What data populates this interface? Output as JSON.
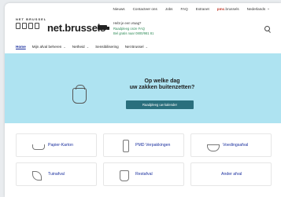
{
  "topnav": {
    "items": [
      "Nieuws",
      "Contacteer ons",
      "Jobs",
      "FAQ",
      "Extranet"
    ],
    "pmc_prefix": "pmc",
    "pmc_suffix": ".brussels",
    "language": "Nederlands"
  },
  "header": {
    "logo_small": "NET BRUSSEL",
    "brand": "net.brussels",
    "help_line1": "Hebt je een vraag?",
    "help_line2": "Raadpleeg onze FAQ",
    "help_line3": "Bel gratis naar 0800/981 81"
  },
  "mainnav": {
    "items": [
      {
        "label": "Home",
        "active": true,
        "dropdown": false
      },
      {
        "label": "Mijn afval beheren",
        "active": false,
        "dropdown": true
      },
      {
        "label": "Netheid",
        "active": false,
        "dropdown": true
      },
      {
        "label": "Sensibilisering",
        "active": false,
        "dropdown": false
      },
      {
        "label": "Net Brussel",
        "active": false,
        "dropdown": true
      }
    ]
  },
  "hero": {
    "title_line1": "Op welke dag",
    "title_line2": "uw zakken buitenzetten?",
    "button": "Raadpleeg uw kalender",
    "bg_color": "#aee3f1"
  },
  "categories": [
    {
      "label": "Papier-Karton",
      "icon": "tray-icon"
    },
    {
      "label": "PMD Verpakkingen",
      "icon": "bottle-icon"
    },
    {
      "label": "Voedingsafval",
      "icon": "bowl-icon"
    },
    {
      "label": "Tuinafval",
      "icon": "leaf-icon"
    },
    {
      "label": "Restafval",
      "icon": "bag-icon"
    },
    {
      "label": "Ander afval",
      "icon": ""
    }
  ]
}
